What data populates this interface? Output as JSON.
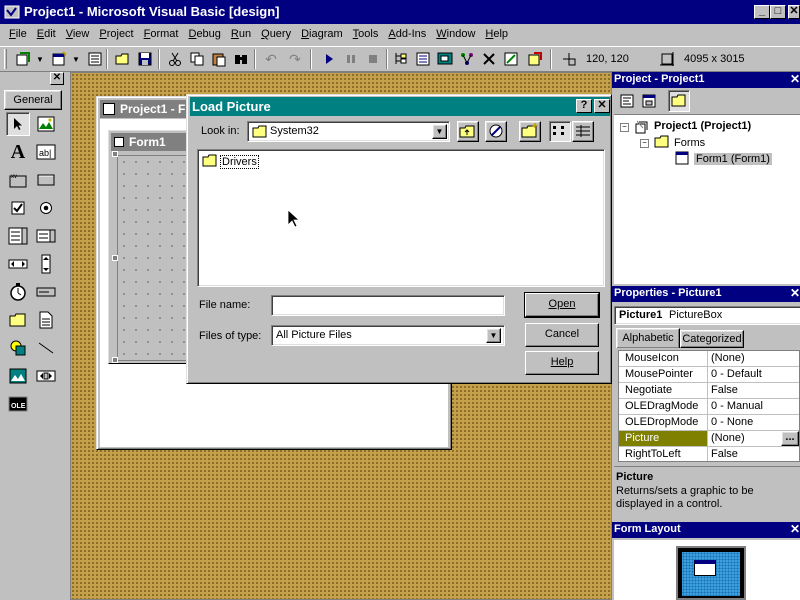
{
  "app": {
    "title": "Project1 - Microsoft Visual Basic [design]",
    "win_min": "_",
    "win_max": "□",
    "win_close": "✕"
  },
  "menu": [
    "File",
    "Edit",
    "View",
    "Project",
    "Format",
    "Debug",
    "Run",
    "Query",
    "Diagram",
    "Tools",
    "Add-Ins",
    "Window",
    "Help"
  ],
  "toolbar": {
    "position_readout": "120, 120",
    "size_readout": "4095 x 3015"
  },
  "toolbox": {
    "tab_label": "General",
    "close": "✕"
  },
  "designer": {
    "project_window_title": "Project1 - F",
    "form_title": "Form1"
  },
  "dialog": {
    "title": "Load Picture",
    "help_glyph": "?",
    "close_glyph": "✕",
    "look_in_label": "Look in:",
    "look_in_value": "System32",
    "files": [
      "Drivers"
    ],
    "file_name_label": "File name:",
    "file_name_value": "",
    "files_of_type_label": "Files of type:",
    "files_of_type_value": "All Picture Files",
    "open_button": "Open",
    "cancel_button": "Cancel",
    "help_button": "Help"
  },
  "project_explorer": {
    "title": "Project - Project1",
    "close": "✕",
    "root": "Project1 (Project1)",
    "folder": "Forms",
    "item": "Form1 (Form1)"
  },
  "properties": {
    "title": "Properties - Picture1",
    "close": "✕",
    "object_name": "Picture1",
    "object_type": "PictureBox",
    "tabs": [
      "Alphabetic",
      "Categorized"
    ],
    "rows": [
      {
        "name": "MouseIcon",
        "value": "(None)"
      },
      {
        "name": "MousePointer",
        "value": "0 - Default"
      },
      {
        "name": "Negotiate",
        "value": "False"
      },
      {
        "name": "OLEDragMode",
        "value": "0 - Manual"
      },
      {
        "name": "OLEDropMode",
        "value": "0 - None"
      },
      {
        "name": "Picture",
        "value": "(None)"
      },
      {
        "name": "RightToLeft",
        "value": "False"
      }
    ],
    "ellipsis": "...",
    "desc_title": "Picture",
    "desc_text": "Returns/sets a graphic to be displayed in a control."
  },
  "form_layout": {
    "title": "Form Layout",
    "close": "✕"
  },
  "colors": {
    "titlebar_active": "#000080",
    "dialog_titlebar": "#008080",
    "face": "#c0c0c0",
    "designer_bg": "#c4a14a",
    "selected_row": "#808000"
  }
}
